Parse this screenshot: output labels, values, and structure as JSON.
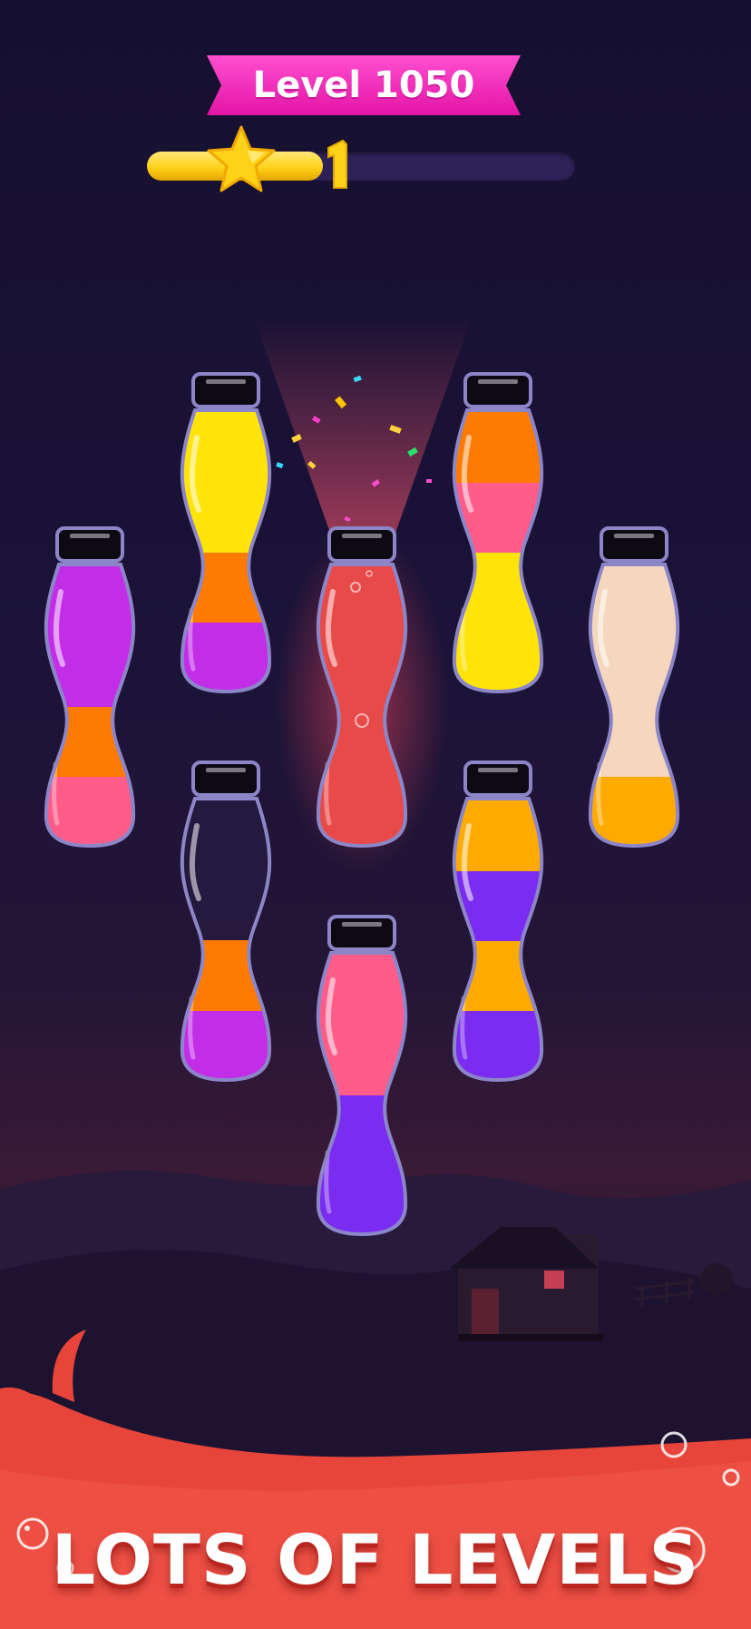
{
  "level": {
    "label": "Level 1050"
  },
  "progress": {
    "fraction": 0.41,
    "stars_earned": 1
  },
  "colors": {
    "yellow": "#ffe40a",
    "orange": "#ff7a00",
    "magenta": "#c22ee8",
    "pink": "#ff5c8a",
    "red": "#e84a4a",
    "purple": "#7a2cf0",
    "amber": "#ffaa00",
    "peach": "#f4d7bd",
    "banner": "#ff2fbf",
    "sea": "#e8453a"
  },
  "bottles": [
    {
      "id": "bottle-1",
      "layers": [
        "pink",
        "orange",
        "magenta",
        "magenta"
      ]
    },
    {
      "id": "bottle-2",
      "layers": [
        "magenta",
        "orange",
        "yellow",
        "yellow"
      ]
    },
    {
      "id": "bottle-3",
      "layers": [
        "red",
        "red",
        "red",
        "red"
      ],
      "selected": true
    },
    {
      "id": "bottle-4",
      "layers": [
        "yellow",
        "yellow",
        "pink",
        "orange"
      ]
    },
    {
      "id": "bottle-5",
      "layers": [
        "amber",
        "peach",
        "peach",
        "peach"
      ]
    },
    {
      "id": "bottle-6",
      "layers": [
        "magenta",
        "orange"
      ]
    },
    {
      "id": "bottle-7",
      "layers": [
        "purple",
        "amber",
        "purple",
        "amber"
      ]
    },
    {
      "id": "bottle-8",
      "layers": [
        "purple",
        "purple",
        "pink",
        "pink"
      ]
    }
  ],
  "footer": {
    "title": "LOTS OF LEVELS"
  }
}
